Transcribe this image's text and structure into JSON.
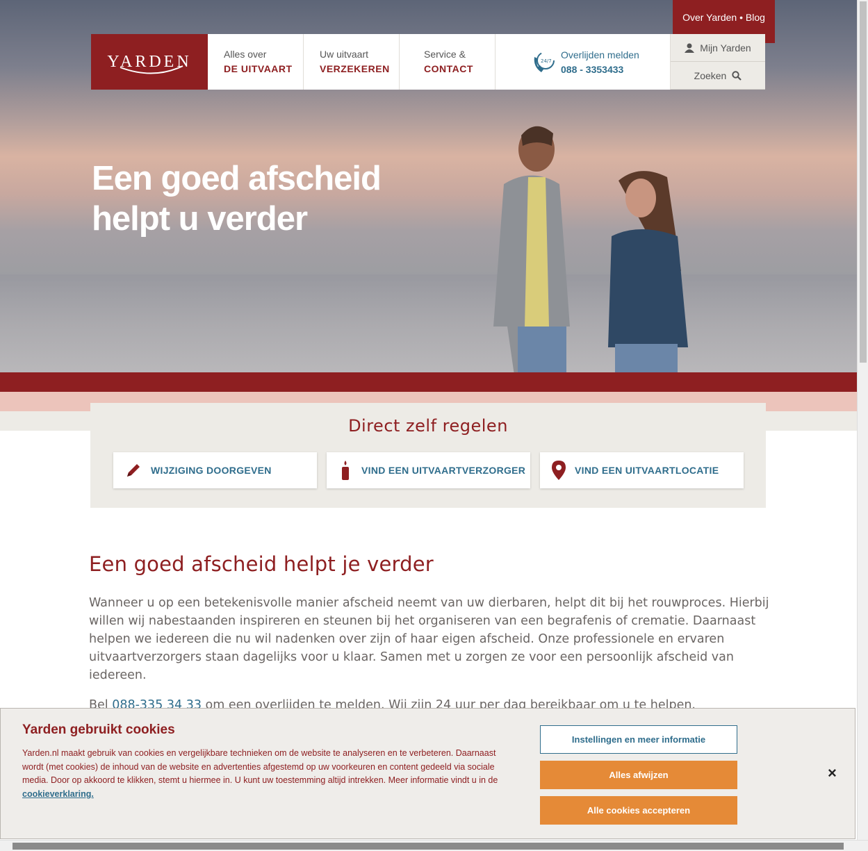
{
  "brand": {
    "logo_text": "YARDEN",
    "red": "#8e1f21",
    "blue": "#2f6d8c",
    "orange": "#e58a37"
  },
  "top_link": "Over Yarden • Blog",
  "nav": {
    "items": [
      {
        "small": "Alles over",
        "big": "DE UITVAART"
      },
      {
        "small": "Uw uitvaart",
        "big": "VERZEKEREN"
      },
      {
        "small": "Service &",
        "big": "CONTACT"
      }
    ],
    "phone": {
      "label": "Overlijden melden",
      "number": "088 - 3353433",
      "icon": "phone-24-7-icon"
    },
    "mijn_yarden": "Mijn Yarden",
    "zoeken": "Zoeken"
  },
  "hero": {
    "line1": "Een goed afscheid",
    "line2": "helpt u verder"
  },
  "direct": {
    "title": "Direct zelf  regelen",
    "cards": [
      {
        "label": "WIJZIGING DOORGEVEN",
        "icon": "pencil-icon"
      },
      {
        "label": "VIND EEN UITVAARTVERZORGER",
        "icon": "candle-icon"
      },
      {
        "label": "VIND EEN UITVAARTLOCATIE",
        "icon": "location-pin-icon"
      }
    ]
  },
  "intro": {
    "title": "Een goed afscheid helpt je verder",
    "text": "Wanneer u op een betekenisvolle manier afscheid neemt van uw dierbaren, helpt dit bij het rouwproces. Hierbij willen wij nabestaanden inspireren en steunen bij het organiseren van een begrafenis of crematie. Daarnaast helpen we iedereen die nu wil nadenken over zijn of haar eigen afscheid. Onze professionele en ervaren uitvaartverzorgers staan dagelijks voor u klaar. Samen met u zorgen ze voor een persoonlijk afscheid van iedereen.",
    "text2_pre": "Bel ",
    "text2_link": "088-335 34 33",
    "text2_post": " om een overlijden te melden. Wij zijn 24 uur per dag bereikbaar om u te helpen."
  },
  "cookie": {
    "title": "Yarden gebruikt cookies",
    "text": "Yarden.nl maakt gebruik van cookies en vergelijkbare technieken om de website te analyseren en te verbeteren. Daarnaast wordt (met cookies) de inhoud van de website en advertenties afgestemd op uw voorkeuren en content gedeeld via sociale media. Door op akkoord te klikken, stemt u hiermee in. U kunt uw toestemming altijd intrekken. Meer informatie vindt u in de ",
    "link": "cookieverklaring.",
    "btn_settings": "Instellingen en meer informatie",
    "btn_reject": "Alles afwijzen",
    "btn_accept": "Alle cookies accepteren",
    "close": "×"
  }
}
